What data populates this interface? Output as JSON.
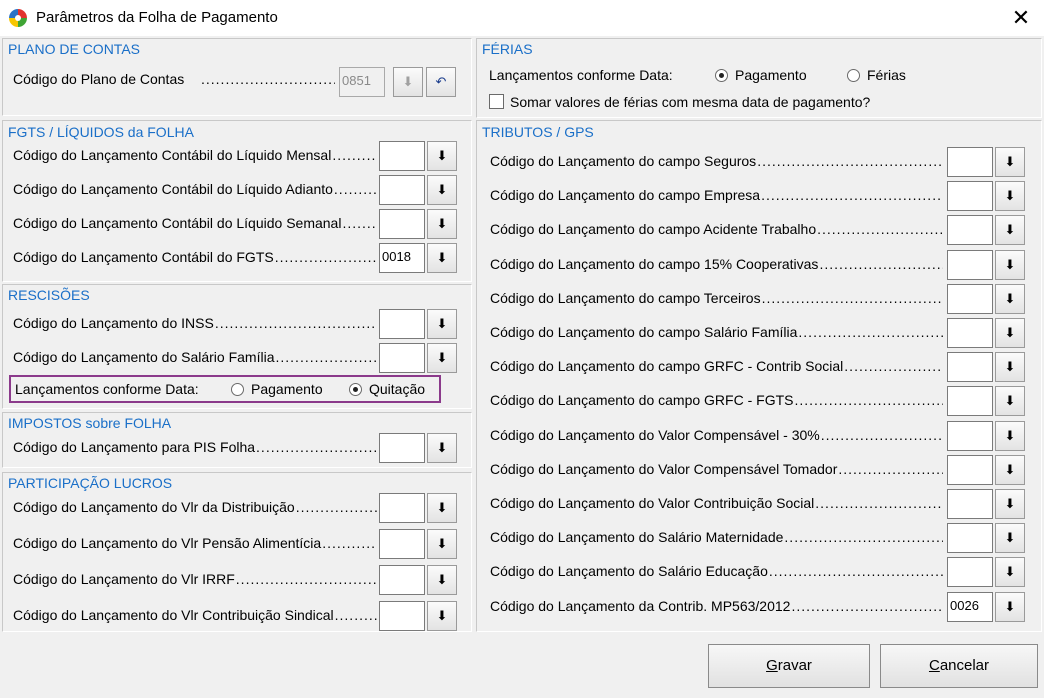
{
  "window": {
    "title": "Parâmetros da Folha de Pagamento"
  },
  "plano": {
    "heading": "PLANO DE CONTAS",
    "label": "Código do Plano de Contas",
    "value": "0851"
  },
  "fgts": {
    "heading": "FGTS / LÍQUIDOS da FOLHA",
    "rows": [
      {
        "label": "Código do Lançamento Contábil do Líquido Mensal",
        "value": ""
      },
      {
        "label": "Código do Lançamento Contábil do Líquido Adianto",
        "value": ""
      },
      {
        "label": "Código do Lançamento Contábil do Líquido Semanal",
        "value": ""
      },
      {
        "label": "Código do Lançamento Contábil do FGTS",
        "value": "0018"
      }
    ]
  },
  "rescisoes": {
    "heading": "RESCISÕES",
    "rows": [
      {
        "label": "Código do Lançamento do INSS",
        "value": ""
      },
      {
        "label": "Código do Lançamento do Salário Família",
        "value": ""
      }
    ],
    "date_label": "Lançamentos conforme Data:",
    "opt1": "Pagamento",
    "opt2": "Quitação",
    "selected": "Quitação"
  },
  "impostos": {
    "heading": "IMPOSTOS sobre FOLHA",
    "rows": [
      {
        "label": "Código do Lançamento para PIS Folha",
        "value": ""
      }
    ]
  },
  "participacao": {
    "heading": "PARTICIPAÇÃO  LUCROS",
    "rows": [
      {
        "label": "Código do Lançamento do Vlr da Distribuição",
        "value": ""
      },
      {
        "label": "Código do Lançamento do Vlr Pensão Alimentícia",
        "value": ""
      },
      {
        "label": "Código do Lançamento do Vlr IRRF",
        "value": ""
      },
      {
        "label": "Código do Lançamento do Vlr Contribuição Sindical",
        "value": ""
      }
    ]
  },
  "ferias": {
    "heading": "FÉRIAS",
    "date_label": "Lançamentos conforme Data:",
    "opt1": "Pagamento",
    "opt2": "Férias",
    "selected": "Pagamento",
    "checkbox_label": "Somar valores de férias com mesma data de pagamento?",
    "checked": false
  },
  "tributos": {
    "heading": "TRIBUTOS /  GPS",
    "rows": [
      {
        "label": "Código do Lançamento do campo Seguros",
        "value": ""
      },
      {
        "label": "Código do Lançamento do campo Empresa",
        "value": ""
      },
      {
        "label": "Código do Lançamento do campo Acidente Trabalho",
        "value": ""
      },
      {
        "label": "Código do Lançamento do campo 15% Cooperativas",
        "value": ""
      },
      {
        "label": "Código do Lançamento do campo Terceiros",
        "value": ""
      },
      {
        "label": "Código do Lançamento do campo Salário Família",
        "value": ""
      },
      {
        "label": "Código do Lançamento do campo GRFC - Contrib Social",
        "value": ""
      },
      {
        "label": "Código do Lançamento do campo GRFC - FGTS",
        "value": ""
      },
      {
        "label": "Código do Lançamento do Valor Compensável - 30%",
        "value": ""
      },
      {
        "label": "Código do Lançamento do Valor Compensável Tomador",
        "value": ""
      },
      {
        "label": "Código do Lançamento do Valor Contribuição Social",
        "value": ""
      },
      {
        "label": "Código do Lançamento do Salário Maternidade",
        "value": ""
      },
      {
        "label": "Código do Lançamento do Salário Educação",
        "value": ""
      },
      {
        "label": "Código do Lançamento da Contrib. MP563/2012",
        "value": "0026"
      }
    ]
  },
  "buttons": {
    "save": "Gravar",
    "cancel": "Cancelar"
  },
  "icons": {
    "download": "download-arrow-icon",
    "undo": "undo-icon",
    "app": "app-logo-icon",
    "close": "close-icon"
  },
  "colors": {
    "heading": "#1a6fc8",
    "highlight_border": "#8b3a8b"
  }
}
